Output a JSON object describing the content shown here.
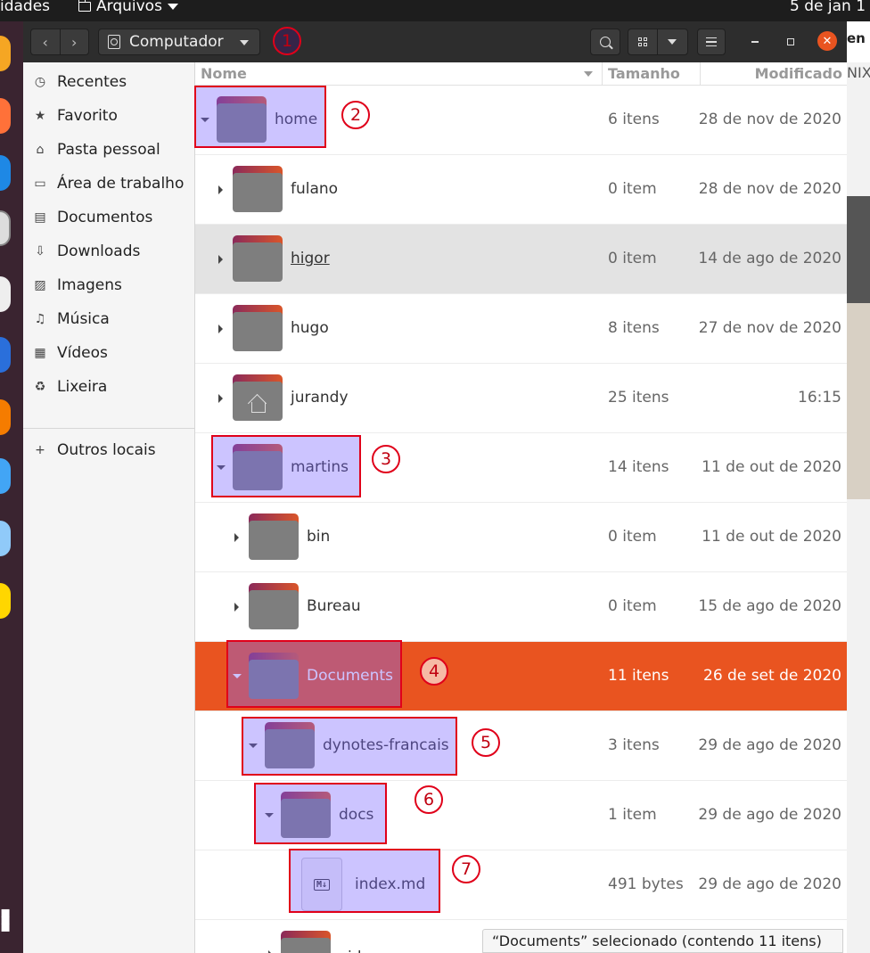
{
  "topbar": {
    "activities": "idades",
    "app_menu": "Arquivos",
    "clock": "5 de jan  1"
  },
  "background": {
    "right_text_1": "en",
    "right_text_2": "NIX"
  },
  "headerbar": {
    "back_glyph": "‹",
    "forward_glyph": "›",
    "location": "Computador",
    "close_glyph": "✕"
  },
  "sidebar": {
    "items": [
      {
        "label": "Recentes",
        "icon": "clock-icon",
        "glyph": "◷"
      },
      {
        "label": "Favorito",
        "icon": "star-icon",
        "glyph": "★"
      },
      {
        "label": "Pasta pessoal",
        "icon": "home-icon",
        "glyph": "⌂"
      },
      {
        "label": "Área de trabalho",
        "icon": "desktop-icon",
        "glyph": "▭"
      },
      {
        "label": "Documentos",
        "icon": "document-icon",
        "glyph": "▤"
      },
      {
        "label": "Downloads",
        "icon": "download-icon",
        "glyph": "⇩"
      },
      {
        "label": "Imagens",
        "icon": "image-icon",
        "glyph": "▨"
      },
      {
        "label": "Música",
        "icon": "music-icon",
        "glyph": "♫"
      },
      {
        "label": "Vídeos",
        "icon": "video-icon",
        "glyph": "▦"
      },
      {
        "label": "Lixeira",
        "icon": "trash-icon",
        "glyph": "♻"
      }
    ],
    "other_locations": {
      "label": "Outros locais",
      "icon": "plus-icon",
      "glyph": "+"
    }
  },
  "columns": {
    "name": "Nome",
    "size": "Tamanho",
    "modified": "Modificado"
  },
  "rows": [
    {
      "name": "home",
      "size": "6 itens",
      "modified": "28 de nov de 2020",
      "level": 0,
      "expanded": true,
      "kind": "folder"
    },
    {
      "name": "fulano",
      "size": "0 item",
      "modified": "28 de nov de 2020",
      "level": 1,
      "expanded": false,
      "kind": "folder"
    },
    {
      "name": "higor",
      "size": "0 item",
      "modified": "14 de ago de 2020",
      "level": 1,
      "expanded": false,
      "kind": "folder",
      "state": "hover"
    },
    {
      "name": "hugo",
      "size": "8 itens",
      "modified": "27 de nov de 2020",
      "level": 1,
      "expanded": false,
      "kind": "folder"
    },
    {
      "name": "jurandy",
      "size": "25 itens",
      "modified": "16:15",
      "level": 1,
      "expanded": false,
      "kind": "home-folder"
    },
    {
      "name": "martins",
      "size": "14 itens",
      "modified": "11 de out de 2020",
      "level": 1,
      "expanded": true,
      "kind": "folder"
    },
    {
      "name": "bin",
      "size": "0 item",
      "modified": "11 de out de 2020",
      "level": 2,
      "expanded": false,
      "kind": "folder"
    },
    {
      "name": "Bureau",
      "size": "0 item",
      "modified": "15 de ago de 2020",
      "level": 2,
      "expanded": false,
      "kind": "folder"
    },
    {
      "name": "Documents",
      "size": "11 itens",
      "modified": "26 de set de 2020",
      "level": 2,
      "expanded": true,
      "kind": "folder",
      "state": "selected"
    },
    {
      "name": "dynotes-francais",
      "size": "3 itens",
      "modified": "29 de ago de 2020",
      "level": 3,
      "expanded": true,
      "kind": "folder"
    },
    {
      "name": "docs",
      "size": "1 item",
      "modified": "29 de ago de 2020",
      "level": 4,
      "expanded": true,
      "kind": "folder"
    },
    {
      "name": "index.md",
      "size": "491 bytes",
      "modified": "29 de ago de 2020",
      "level": 5,
      "kind": "markdown-file",
      "badge": "M↓"
    },
    {
      "name": "video",
      "size": "",
      "modified": "",
      "level": 4,
      "expanded": false,
      "kind": "folder"
    }
  ],
  "annotations": [
    "1",
    "2",
    "3",
    "4",
    "5",
    "6",
    "7"
  ],
  "statusbar": "“Documents” selecionado (contendo 11 itens)",
  "colors": {
    "accent": "#e95420",
    "headerbar": "#2d2d2d",
    "highlight": "#7864ff",
    "annotation": "#e0001a"
  }
}
